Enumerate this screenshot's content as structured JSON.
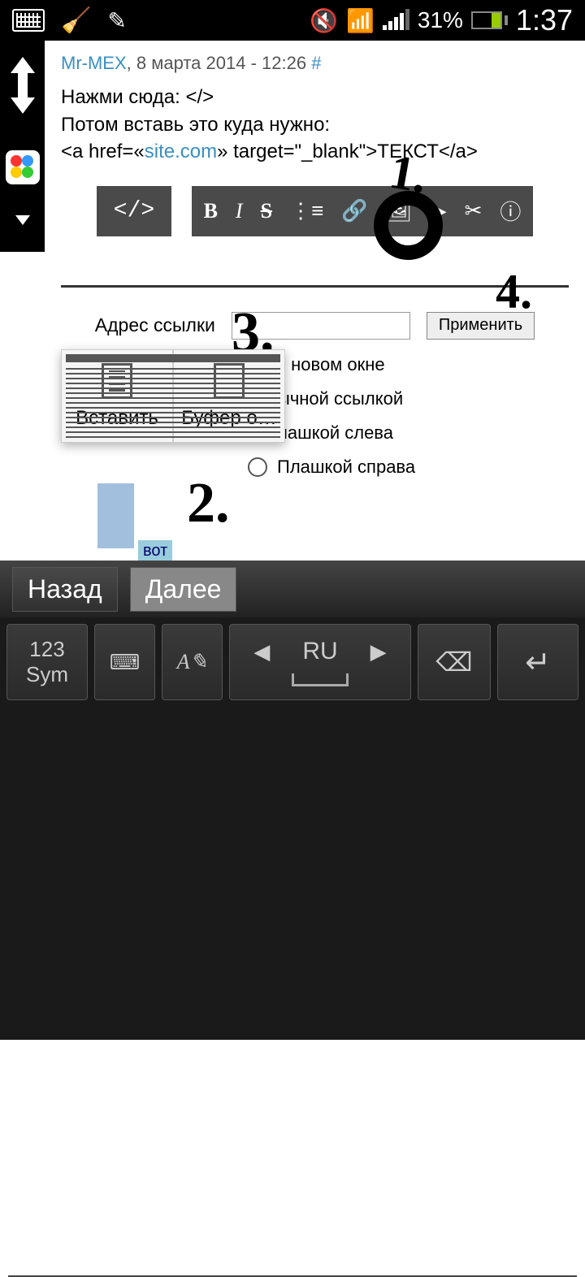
{
  "status": {
    "battery_pct": "31%",
    "time": "1:37"
  },
  "post": {
    "user": "Mr-MEX",
    "date": "8 марта 2014 - 12:26",
    "hash": "#",
    "line1": "Нажми сюда: </>",
    "line2": "Потом вставь это куда нужно:",
    "code_pre": "<a href=«",
    "code_link": "site.com",
    "code_post": "» target=\"_blank\">ТЕКСТ</a>"
  },
  "toolbar": {
    "code": "</>",
    "bold": "B",
    "italic": "I",
    "strike": "S",
    "list": "⋮≡",
    "link": "🔗",
    "image": "🖼",
    "play": "▶",
    "cut": "✂",
    "info": "ⓘ"
  },
  "annotations": {
    "n1": "1.",
    "n2": "2.",
    "n3": "3.",
    "n4": "4."
  },
  "form": {
    "address_label": "Адрес ссылки",
    "apply": "Применить",
    "newwindow": "В новом окне",
    "opt1": "ычной ссылкой",
    "opt2": "лашкой слева",
    "opt3": "Плашкой справа"
  },
  "context": {
    "paste": "Вставить",
    "buffer": "Буфер о…"
  },
  "vot": "вот",
  "kb": {
    "back": "Назад",
    "next": "Далее",
    "sym1": "123",
    "sym2": "Sym",
    "lang": "RU"
  }
}
